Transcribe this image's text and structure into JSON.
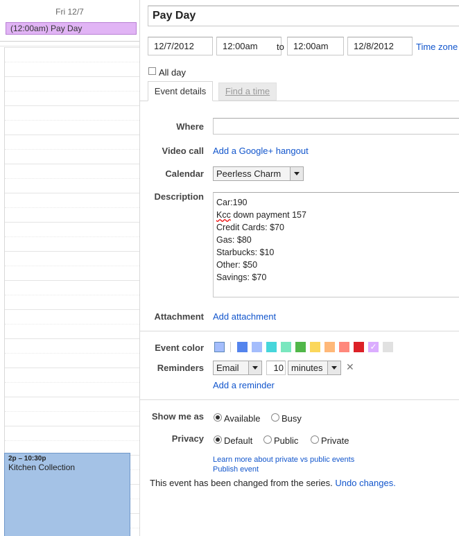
{
  "calendar": {
    "day_header": "Fri 12/7",
    "allday_event": "(12:00am) Pay Day",
    "timed_event": {
      "time": "2p – 10:30p",
      "title": "Kitchen Collection"
    }
  },
  "event": {
    "title": "Pay Day",
    "start_date": "12/7/2012",
    "start_time": "12:00am",
    "to_label": "to",
    "end_time": "12:00am",
    "end_date": "12/8/2012",
    "timezone_link": "Time zone",
    "allday_label": "All day",
    "tabs": [
      {
        "label": "Event details"
      },
      {
        "label": "Find a time"
      }
    ]
  },
  "details": {
    "where_label": "Where",
    "where_value": "",
    "videocall_label": "Video call",
    "videocall_link": "Add a Google+ hangout",
    "calendar_label": "Calendar",
    "calendar_value": "Peerless Charm",
    "description_label": "Description",
    "description_lines": [
      "Car:190",
      "Kcc",
      " down payment 157",
      "Credit Cards: $70",
      "Gas: $80",
      "Starbucks: $10",
      "Other: $50",
      "Savings: $70"
    ],
    "attachment_label": "Attachment",
    "attachment_link": "Add attachment",
    "event_color_label": "Event color",
    "colors": [
      "#a4bdfc",
      "#5484ed",
      "#a4bdfc",
      "#46d6db",
      "#7ae7bf",
      "#51b749",
      "#fbd75b",
      "#ffb878",
      "#ff887c",
      "#dc2127",
      "#dbadff",
      "#e1e1e1"
    ],
    "reminders_label": "Reminders",
    "reminder_method": "Email",
    "reminder_amount": "10",
    "reminder_unit": "minutes",
    "add_reminder_link": "Add a reminder",
    "show_me_as_label": "Show me as",
    "available_label": "Available",
    "busy_label": "Busy",
    "privacy_label": "Privacy",
    "default_label": "Default",
    "public_label": "Public",
    "private_label": "Private",
    "learn_more_link": "Learn more about private vs public events",
    "publish_link": "Publish event",
    "changed_text": "This event has been changed from the series.",
    "undo_link": "Undo changes."
  }
}
